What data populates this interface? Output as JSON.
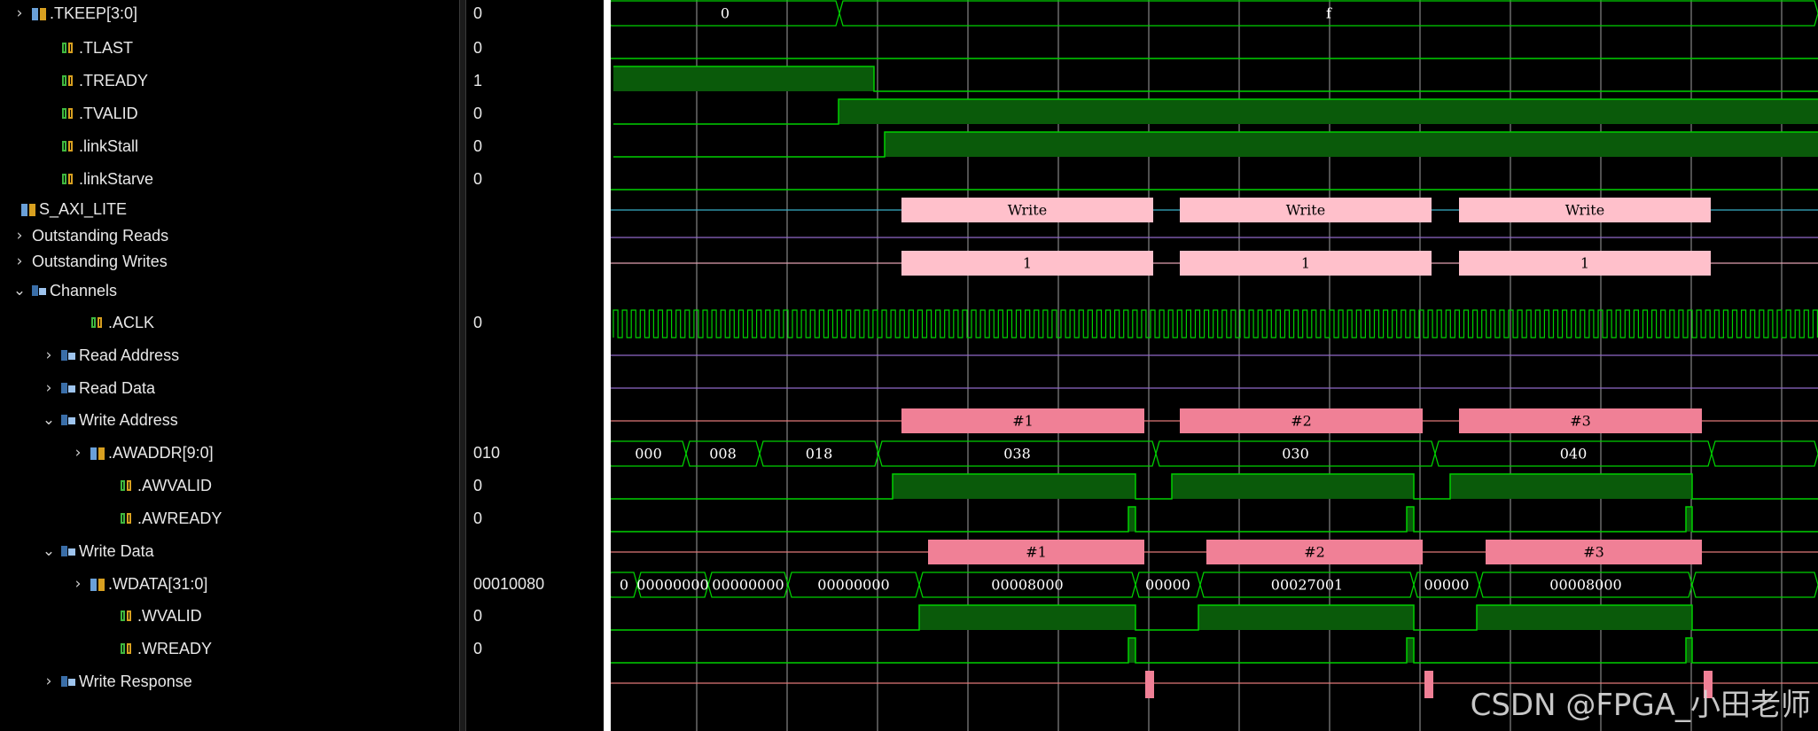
{
  "signals": [
    {
      "name": ".TKEEP[3:0]",
      "value": "0",
      "indent": 1,
      "chevron": "right",
      "icon": "bus"
    },
    {
      "name": ".TLAST",
      "value": "0",
      "indent": 2,
      "chevron": "none",
      "icon": "sig"
    },
    {
      "name": ".TREADY",
      "value": "1",
      "indent": 2,
      "chevron": "none",
      "icon": "sig"
    },
    {
      "name": ".TVALID",
      "value": "0",
      "indent": 2,
      "chevron": "none",
      "icon": "sig"
    },
    {
      "name": ".linkStall",
      "value": "0",
      "indent": 2,
      "chevron": "none",
      "icon": "sig"
    },
    {
      "name": ".linkStarve",
      "value": "0",
      "indent": 2,
      "chevron": "none",
      "icon": "sig"
    },
    {
      "name": "S_AXI_LITE",
      "value": "",
      "indent": 0,
      "chevron": "none",
      "icon": "bus"
    },
    {
      "name": "Outstanding Reads",
      "value": "",
      "indent": 1,
      "chevron": "right",
      "icon": "none"
    },
    {
      "name": "Outstanding Writes",
      "value": "",
      "indent": 1,
      "chevron": "right",
      "icon": "none"
    },
    {
      "name": "Channels",
      "value": "",
      "indent": 1,
      "chevron": "down",
      "icon": "grp"
    },
    {
      "name": ".ACLK",
      "value": "0",
      "indent": 3,
      "chevron": "none",
      "icon": "sig"
    },
    {
      "name": "Read Address",
      "value": "",
      "indent": 2,
      "chevron": "right",
      "icon": "grp"
    },
    {
      "name": "Read Data",
      "value": "",
      "indent": 2,
      "chevron": "right",
      "icon": "grp"
    },
    {
      "name": "Write Address",
      "value": "",
      "indent": 2,
      "chevron": "down",
      "icon": "grp"
    },
    {
      "name": ".AWADDR[9:0]",
      "value": "010",
      "indent": 3,
      "chevron": "right",
      "icon": "bus"
    },
    {
      "name": ".AWVALID",
      "value": "0",
      "indent": 4,
      "chevron": "none",
      "icon": "sig"
    },
    {
      "name": ".AWREADY",
      "value": "0",
      "indent": 4,
      "chevron": "none",
      "icon": "sig"
    },
    {
      "name": "Write Data",
      "value": "",
      "indent": 2,
      "chevron": "down",
      "icon": "grp"
    },
    {
      "name": ".WDATA[31:0]",
      "value": "00010080",
      "indent": 3,
      "chevron": "right",
      "icon": "bus"
    },
    {
      "name": ".WVALID",
      "value": "0",
      "indent": 4,
      "chevron": "none",
      "icon": "sig"
    },
    {
      "name": ".WREADY",
      "value": "0",
      "indent": 4,
      "chevron": "none",
      "icon": "sig"
    },
    {
      "name": "Write Response",
      "value": "",
      "indent": 2,
      "chevron": "right",
      "icon": "grp"
    }
  ],
  "waves": {
    "tkeep": [
      "0",
      "f"
    ],
    "write_txn_labels": [
      "Write",
      "Write",
      "Write"
    ],
    "outstanding_labels": [
      "1",
      "1",
      "1"
    ],
    "aw_txn_labels": [
      "#1",
      "#2",
      "#3"
    ],
    "awaddr": [
      "000",
      "008",
      "018",
      "038",
      "030",
      "040"
    ],
    "w_txn_labels": [
      "#1",
      "#2",
      "#3"
    ],
    "wdata": [
      "0",
      "00000000",
      "00000000",
      "00000000",
      "00008000",
      "00000",
      "00027001",
      "00000",
      "00008000"
    ]
  },
  "colors": {
    "signal_green": "#00d000",
    "fill_green": "#0a5a0a",
    "txn_light": "#ffc0cb",
    "txn_dark": "#f08096",
    "grid": "#d8d8d8"
  },
  "watermark": "CSDN @FPGA_小田老师"
}
